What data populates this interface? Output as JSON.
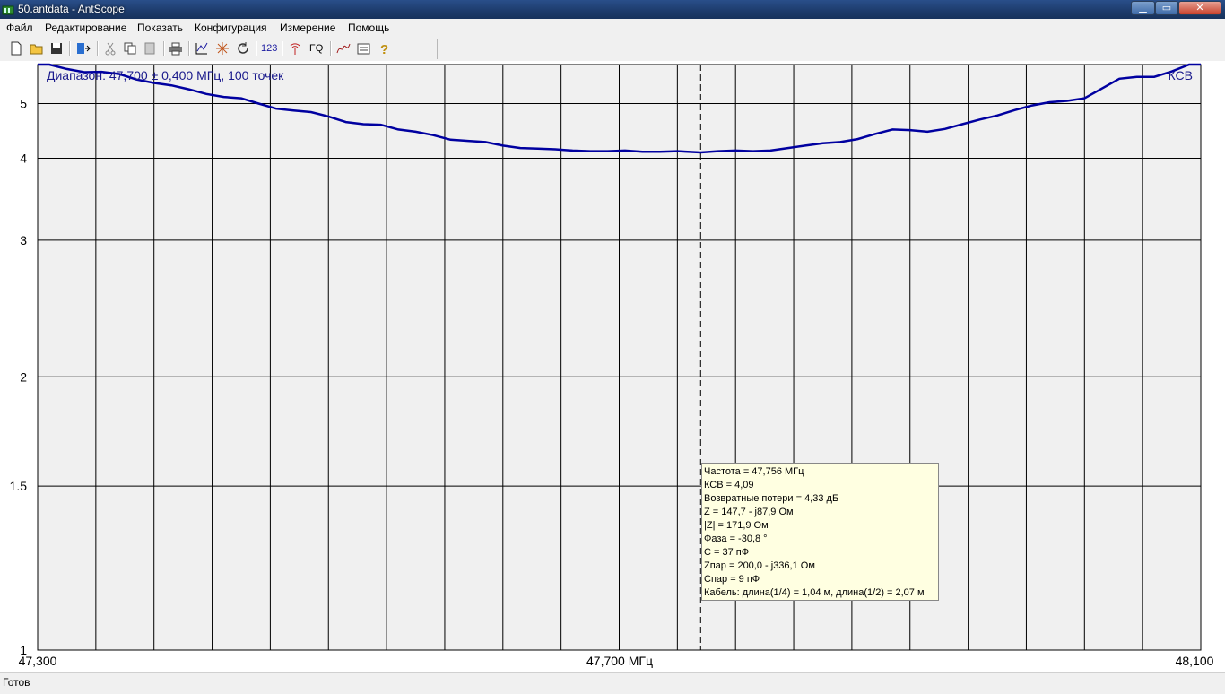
{
  "window": {
    "title": "50.antdata - AntScope",
    "minimize": "▁",
    "maximize": "▭",
    "close": "✕"
  },
  "menu": [
    "Файл",
    "Редактирование",
    "Показать",
    "Конфигурация",
    "Измерение",
    "Помощь"
  ],
  "toolbar": {
    "icons": [
      "new-icon",
      "open-icon",
      "save-icon",
      "export-icon",
      "cut-icon",
      "copy-icon",
      "paste-icon",
      "print-icon",
      "graph-icon",
      "marker-icon",
      "refresh-icon",
      "numbers-icon",
      "antenna-icon",
      "fq-icon",
      "chart-mode-icon",
      "notes-icon",
      "help-icon"
    ],
    "label_123": "123",
    "label_fq": "FQ"
  },
  "chart": {
    "range_label": "Диапазон: 47,700 ± 0,400 МГц, 100 точек",
    "mode_label": "КСВ",
    "x_tick_left": "47,300",
    "x_tick_center": "47,700 МГц",
    "x_tick_right": "48,100",
    "line_color": "#0000a0"
  },
  "chart_data": {
    "type": "line",
    "title": "",
    "xlabel": "",
    "ylabel": "КСВ",
    "xlim": [
      47.3,
      48.1
    ],
    "ylim": [
      1,
      6
    ],
    "y_scale": "swr",
    "yticks": [
      "5",
      "4",
      "3",
      "2",
      "1.5",
      "1"
    ],
    "ytick_values": [
      5,
      4,
      3,
      2,
      1.5,
      1
    ],
    "grid": true,
    "cursor_x": 47.756,
    "series": [
      {
        "name": "КСВ",
        "x": [
          47.3,
          47.308,
          47.32,
          47.332,
          47.344,
          47.356,
          47.368,
          47.38,
          47.392,
          47.404,
          47.416,
          47.428,
          47.44,
          47.452,
          47.464,
          47.476,
          47.488,
          47.5,
          47.512,
          47.524,
          47.536,
          47.548,
          47.56,
          47.572,
          47.584,
          47.596,
          47.608,
          47.62,
          47.632,
          47.644,
          47.656,
          47.668,
          47.68,
          47.692,
          47.704,
          47.716,
          47.728,
          47.74,
          47.756,
          47.768,
          47.78,
          47.792,
          47.804,
          47.816,
          47.828,
          47.84,
          47.852,
          47.864,
          47.876,
          47.888,
          47.9,
          47.912,
          47.924,
          47.936,
          47.948,
          47.96,
          47.972,
          47.984,
          47.996,
          48.008,
          48.02,
          48.032,
          48.044,
          48.056,
          48.068,
          48.08,
          48.092,
          48.1
        ],
        "y": [
          6.0,
          6.0,
          5.87,
          5.78,
          5.79,
          5.73,
          5.58,
          5.49,
          5.43,
          5.33,
          5.22,
          5.15,
          5.12,
          5.0,
          4.89,
          4.85,
          4.82,
          4.73,
          4.62,
          4.58,
          4.57,
          4.48,
          4.44,
          4.38,
          4.3,
          4.28,
          4.26,
          4.2,
          4.16,
          4.15,
          4.14,
          4.12,
          4.11,
          4.11,
          4.12,
          4.1,
          4.1,
          4.11,
          4.09,
          4.11,
          4.12,
          4.11,
          4.12,
          4.16,
          4.2,
          4.24,
          4.26,
          4.31,
          4.4,
          4.48,
          4.47,
          4.44,
          4.49,
          4.58,
          4.67,
          4.75,
          4.86,
          4.96,
          5.03,
          5.06,
          5.12,
          5.35,
          5.6,
          5.65,
          5.65,
          5.8,
          6.0,
          6.0
        ]
      }
    ]
  },
  "info": {
    "lines": [
      "Частота = 47,756 МГц",
      "КСВ = 4,09",
      "Возвратные потери = 4,33 дБ",
      "Z = 147,7 - j87,9 Ом",
      "|Z| = 171,9 Ом",
      "Фаза = -30,8 °",
      "C = 37 пФ",
      "Zпар = 200,0 - j336,1 Ом",
      "Cпар = 9 пФ",
      "Кабель: длина(1/4) = 1,04 м, длина(1/2) = 2,07 м"
    ]
  },
  "status": {
    "text": "Готов"
  }
}
